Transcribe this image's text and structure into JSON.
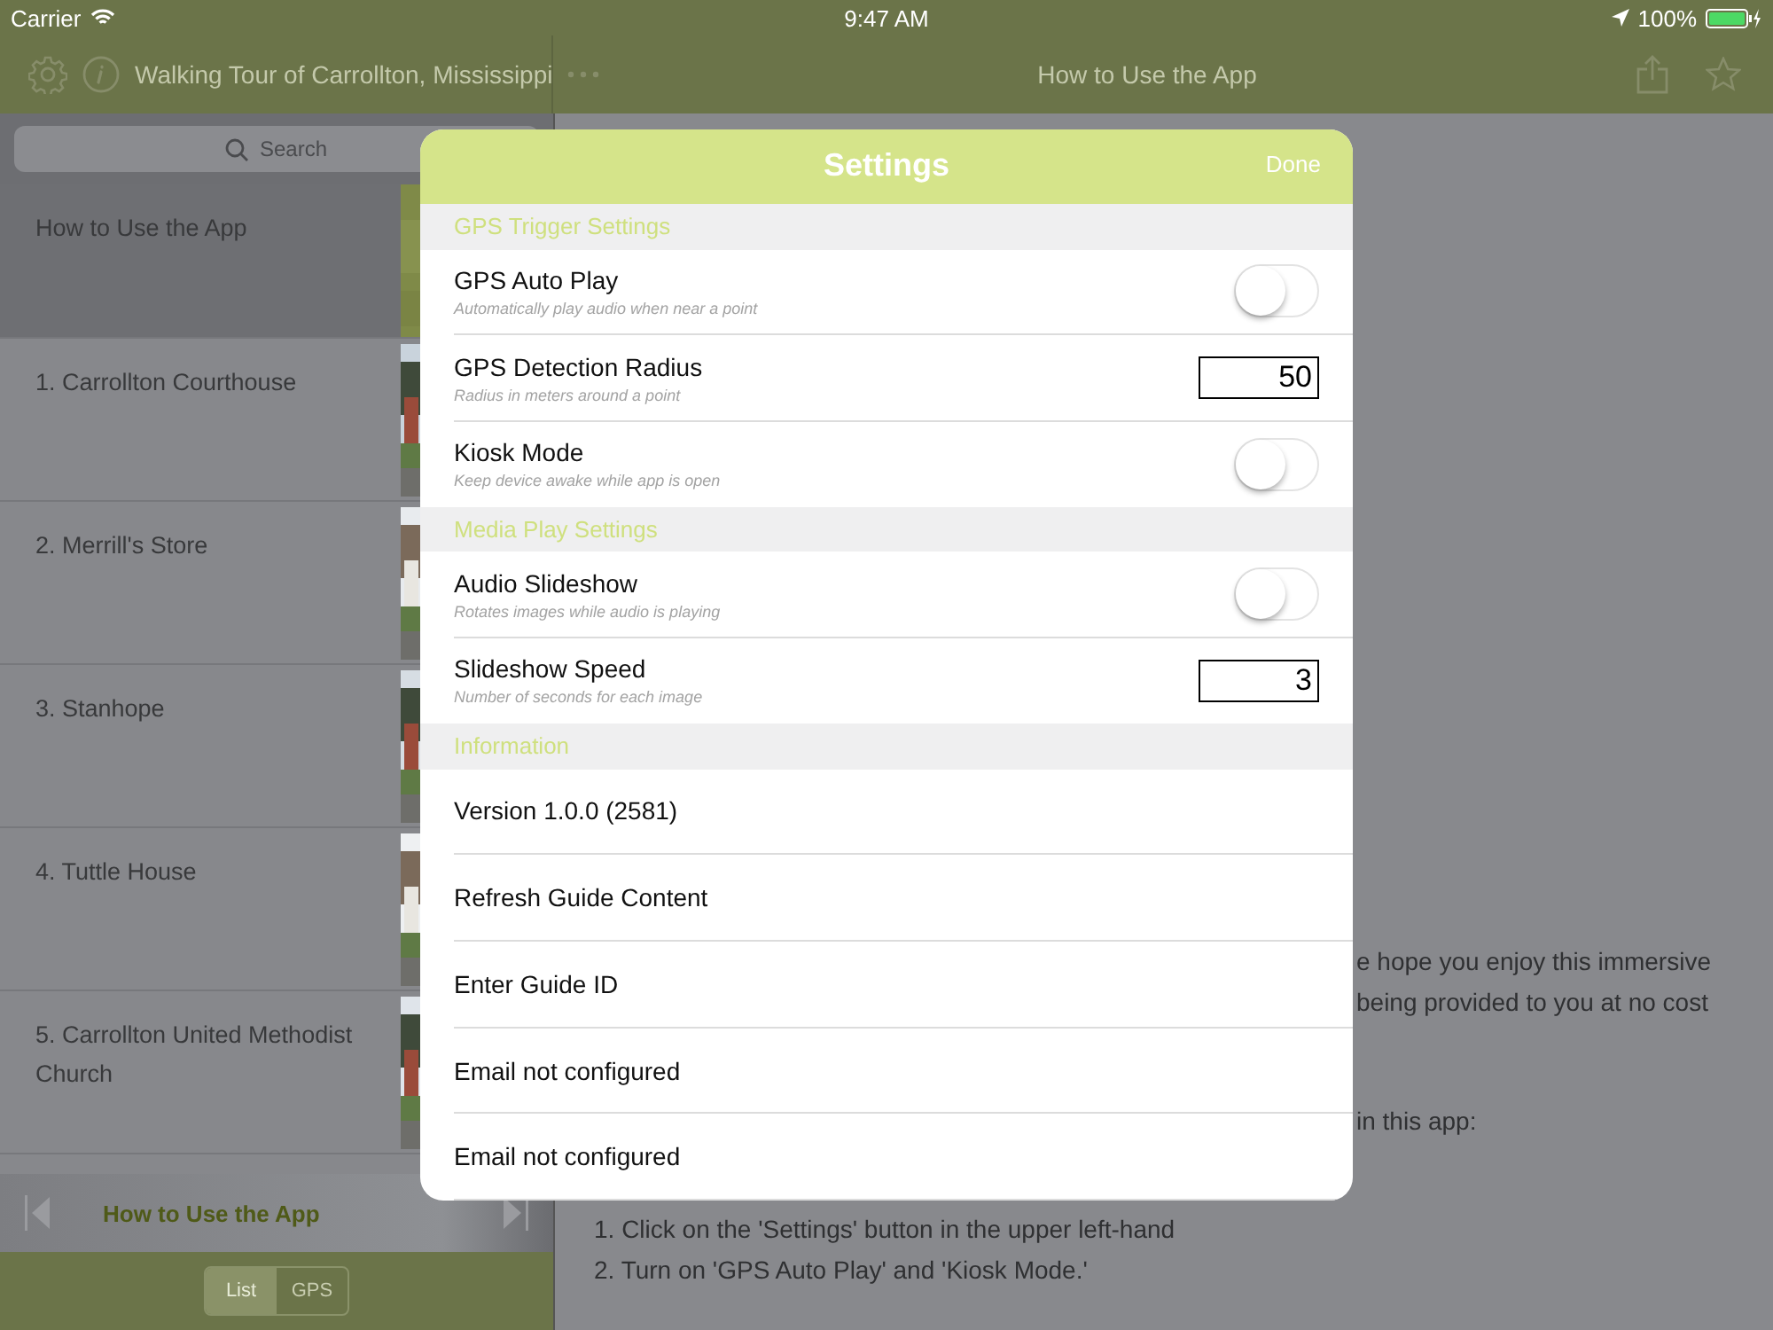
{
  "status_bar": {
    "carrier": "Carrier",
    "time": "9:47 AM",
    "battery": "100%"
  },
  "sidebar": {
    "title": "Walking Tour of Carrollton, Mississippi",
    "search": {
      "placeholder": "Search"
    },
    "items": [
      {
        "label": "How to Use the App",
        "selected": true
      },
      {
        "label": "1. Carrollton Courthouse",
        "selected": false
      },
      {
        "label": "2. Merrill's Store",
        "selected": false
      },
      {
        "label": "3. Stanhope",
        "selected": false
      },
      {
        "label": "4. Tuttle House",
        "selected": false
      },
      {
        "label": "5. Carrollton United Methodist Church",
        "selected": false
      }
    ],
    "player": {
      "title": "How to Use the App"
    },
    "segments": [
      {
        "label": "List",
        "selected": true
      },
      {
        "label": "GPS",
        "selected": false
      }
    ]
  },
  "detail": {
    "title": "How to Use the App",
    "fragments": [
      "e hope you enjoy this immersive",
      "being provided to you at no cost",
      "in this app:"
    ],
    "lines": [
      "1. Click on the 'Settings' button in the upper left-hand",
      "2. Turn on 'GPS Auto Play' and 'Kiosk Mode.'"
    ]
  },
  "settings": {
    "title": "Settings",
    "done": "Done",
    "sections": [
      {
        "title": "GPS Trigger Settings",
        "rows": [
          {
            "kind": "toggle",
            "label": "GPS Auto Play",
            "detail": "Automatically play audio when near a point",
            "on": false
          },
          {
            "kind": "number",
            "label": "GPS Detection Radius",
            "detail": "Radius in meters around a point",
            "value": "50"
          },
          {
            "kind": "toggle",
            "label": "Kiosk Mode",
            "detail": "Keep device awake while app is open",
            "on": false
          }
        ]
      },
      {
        "title": "Media Play Settings",
        "rows": [
          {
            "kind": "toggle",
            "label": "Audio Slideshow",
            "detail": "Rotates images while audio is playing",
            "on": false
          },
          {
            "kind": "number",
            "label": "Slideshow Speed",
            "detail": "Number of seconds for each image",
            "value": "3"
          }
        ]
      },
      {
        "title": "Information",
        "rows": [
          {
            "kind": "link",
            "label": "Version 1.0.0 (2581)"
          },
          {
            "kind": "link",
            "label": "Refresh Guide Content"
          },
          {
            "kind": "link",
            "label": "Enter Guide ID"
          },
          {
            "kind": "link",
            "label": "Email not configured"
          },
          {
            "kind": "link",
            "label": "Email not configured"
          }
        ]
      }
    ]
  }
}
